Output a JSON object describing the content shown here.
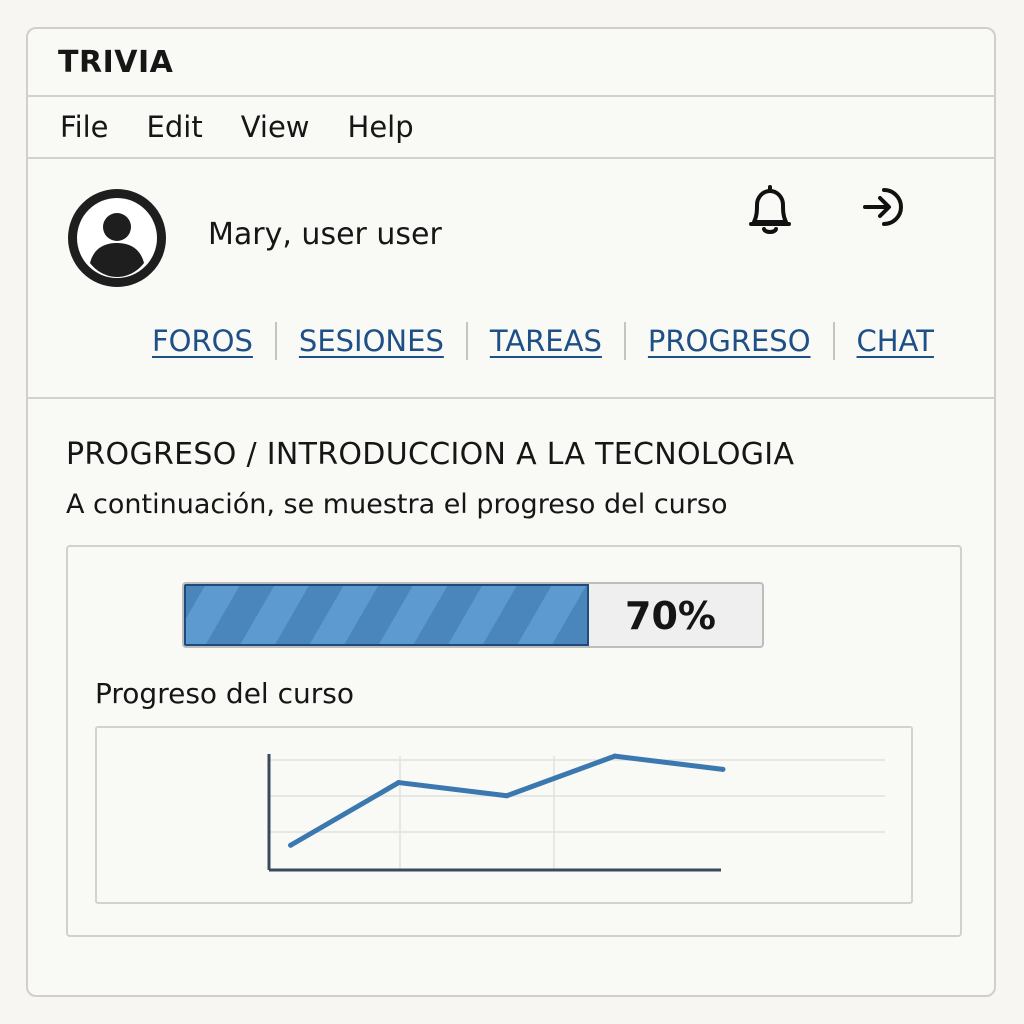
{
  "window": {
    "title": "TRIVIA"
  },
  "menu": {
    "items": [
      "File",
      "Edit",
      "View",
      "Help"
    ]
  },
  "user": {
    "name": "Mary, user user"
  },
  "icons": {
    "avatar": "user-avatar-icon",
    "notifications": "bell-icon",
    "logout": "logout-icon"
  },
  "nav": {
    "links": [
      "FOROS",
      "SESIONES",
      "TAREAS",
      "PROGRESO",
      "CHAT"
    ]
  },
  "page": {
    "title": "PROGRESO / INTRODUCCION A LA TECNOLOGIA",
    "subtitle": "A continuación, se muestra el progreso del curso"
  },
  "progress": {
    "fraction": 0.7,
    "label": "70%"
  },
  "colors": {
    "accent": "#3b78b0",
    "link": "#1e4f86",
    "progress_fill": "#4a86bb"
  },
  "chart_data": {
    "type": "line",
    "title": "Progreso del curso",
    "x": [
      1,
      2,
      3,
      4,
      5
    ],
    "series": [
      {
        "values": [
          20,
          58,
          50,
          74,
          66
        ]
      }
    ],
    "xlim": [
      0.8,
      6.5
    ],
    "ylim": [
      5,
      85
    ],
    "grid": true
  }
}
